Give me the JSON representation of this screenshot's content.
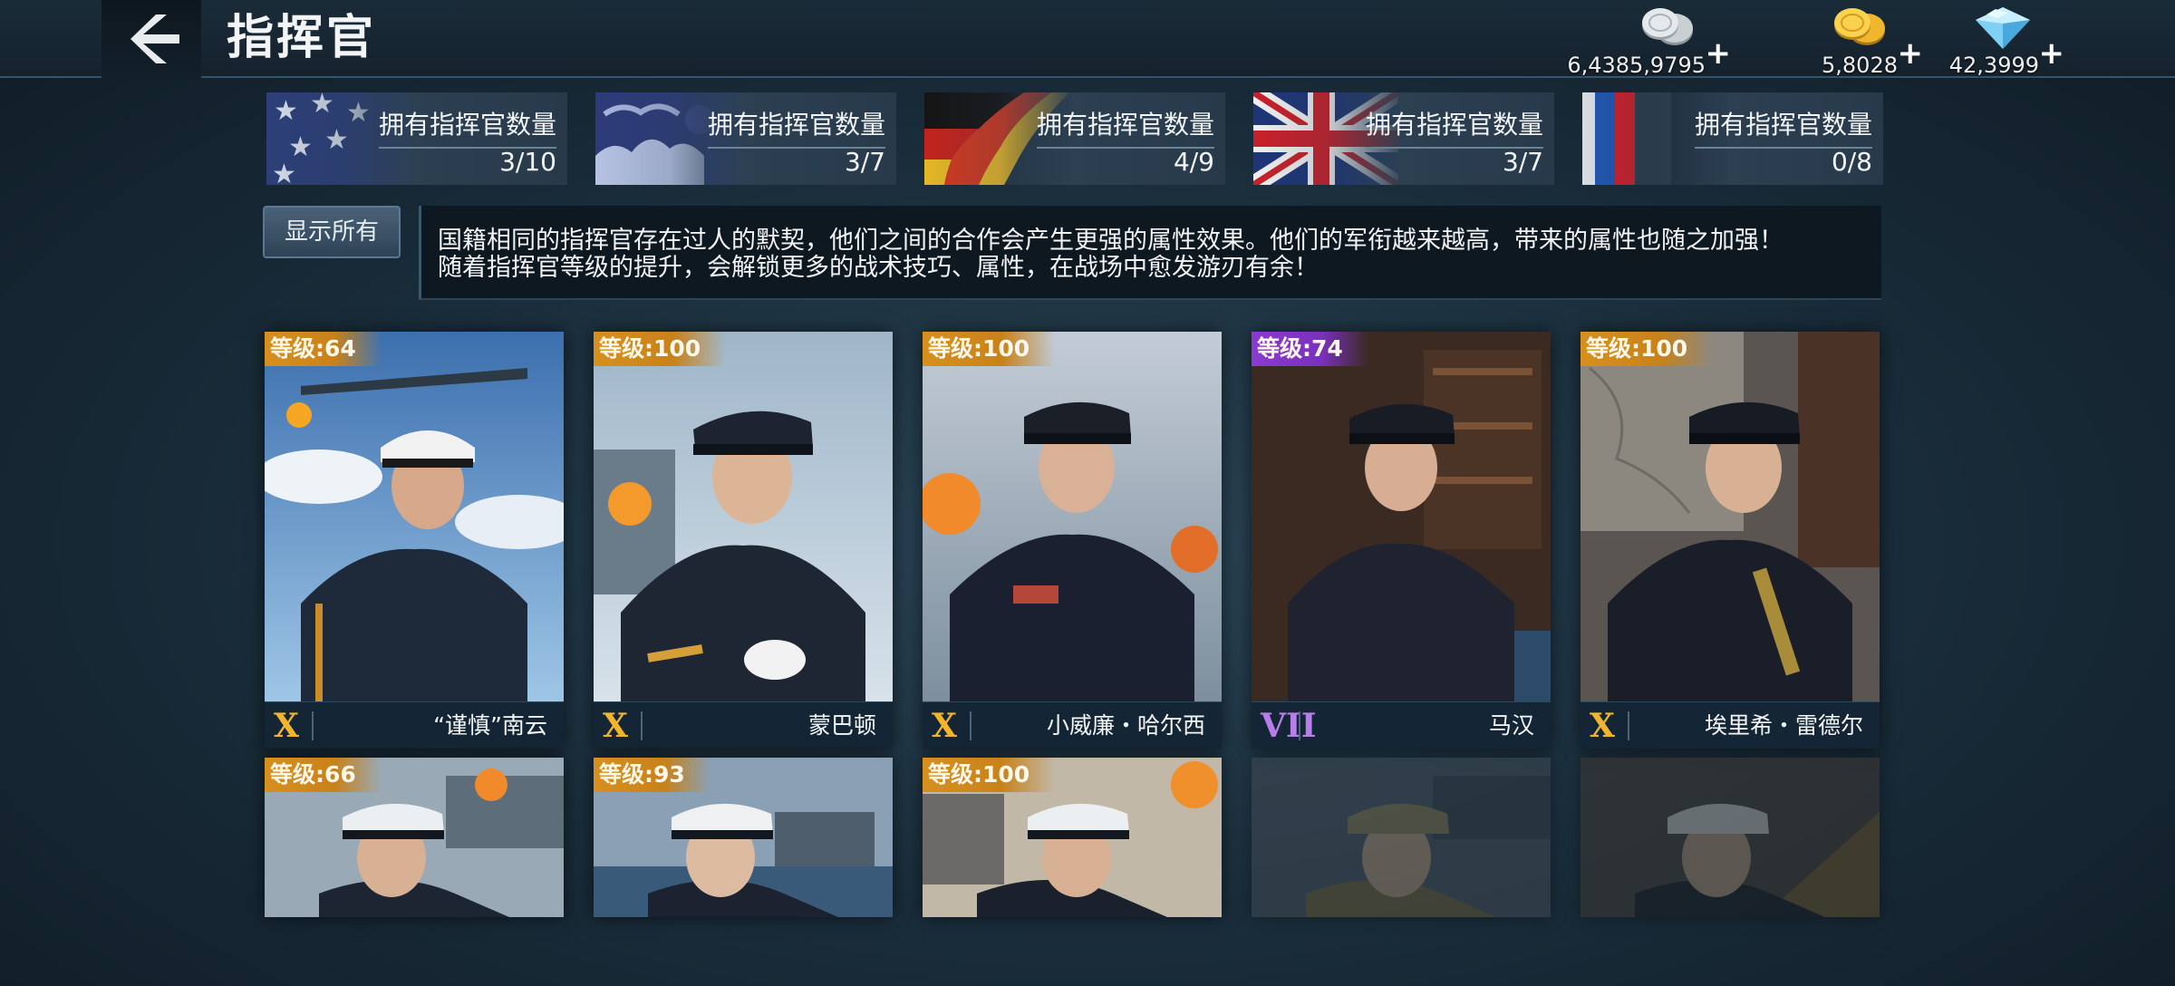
{
  "header": {
    "title": "指挥官",
    "currencies": [
      {
        "icon": "silver-coin-icon",
        "amount": "6,4385,9795",
        "plus": "+"
      },
      {
        "icon": "gold-coin-icon",
        "amount": "5,8028",
        "plus": "+"
      },
      {
        "icon": "diamond-icon",
        "amount": "42,3999",
        "plus": "+"
      }
    ]
  },
  "nations": [
    {
      "flag": "usa-flag",
      "label": "拥有指挥官数量",
      "count": "3/10"
    },
    {
      "flag": "japan-flag",
      "label": "拥有指挥官数量",
      "count": "3/7"
    },
    {
      "flag": "germany-flag",
      "label": "拥有指挥官数量",
      "count": "4/9"
    },
    {
      "flag": "uk-flag",
      "label": "拥有指挥官数量",
      "count": "3/7"
    },
    {
      "flag": "ussr-flag",
      "label": "拥有指挥官数量",
      "count": "0/8"
    }
  ],
  "filter": {
    "show_all_label": "显示所有"
  },
  "description": {
    "line1": "国籍相同的指挥官存在过人的默契，他们之间的合作会产生更强的属性效果。他们的军衔越来越高，带来的属性也随之加强！",
    "line2": "随着指挥官等级的提升，会解锁更多的战术技巧、属性，在战场中愈发游刃有余！"
  },
  "commanders": [
    {
      "level": "等级:64",
      "rank": "X",
      "name": "“谨慎”南云",
      "badge_color": "#d7901f"
    },
    {
      "level": "等级:100",
      "rank": "X",
      "name": "蒙巴顿",
      "badge_color": "#d7901f"
    },
    {
      "level": "等级:100",
      "rank": "X",
      "name": "小威廉・哈尔西",
      "badge_color": "#d7901f"
    },
    {
      "level": "等级:74",
      "rank": "VII",
      "name": "马汉",
      "badge_color": "#8b3bd0"
    },
    {
      "level": "等级:100",
      "rank": "X",
      "name": "埃里希・雷德尔",
      "badge_color": "#d7901f"
    },
    {
      "level": "等级:66",
      "rank": "",
      "name": "",
      "badge_color": "#d7901f"
    },
    {
      "level": "等级:93",
      "rank": "",
      "name": "",
      "badge_color": "#d7901f"
    },
    {
      "level": "等级:100",
      "rank": "",
      "name": "",
      "badge_color": "#d7901f"
    },
    {
      "level": "",
      "rank": "",
      "name": "",
      "badge_color": ""
    },
    {
      "level": "",
      "rank": "",
      "name": "",
      "badge_color": ""
    }
  ]
}
